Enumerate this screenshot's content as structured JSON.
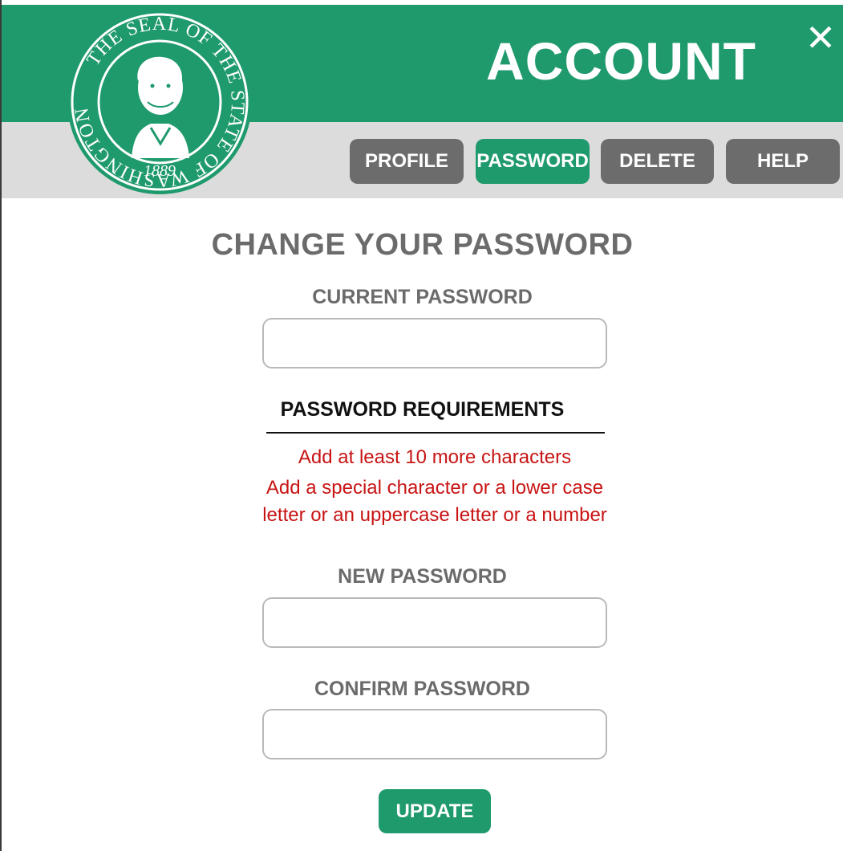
{
  "window": {
    "title": "ACCOUNT",
    "close_label": "✕"
  },
  "logo": {
    "name": "seal-of-the-state-of-washington",
    "ring_text": "THE SEAL OF THE STATE OF WASHINGTON",
    "year": "1889"
  },
  "tabs": [
    {
      "label": "PROFILE",
      "active": false
    },
    {
      "label": "PASSWORD",
      "active": true
    },
    {
      "label": "DELETE",
      "active": false
    },
    {
      "label": "HELP",
      "active": false
    }
  ],
  "form": {
    "heading": "CHANGE YOUR PASSWORD",
    "current_password": {
      "label": "CURRENT PASSWORD",
      "value": "",
      "placeholder": ""
    },
    "requirements": {
      "heading": "PASSWORD REQUIREMENTS",
      "items": [
        "Add at least 10 more characters",
        "Add a special character or a lower case letter or an uppercase letter or a number"
      ]
    },
    "new_password": {
      "label": "NEW PASSWORD",
      "value": "",
      "placeholder": ""
    },
    "confirm_password": {
      "label": "CONFIRM PASSWORD",
      "value": "",
      "placeholder": ""
    },
    "submit_label": "UPDATE"
  },
  "colors": {
    "brand_green": "#1f9a6c",
    "tab_inactive": "#6c6c6c",
    "header_band": "#dcdcdc",
    "label_grey": "#6b6b6b",
    "error_red": "#c81414"
  }
}
